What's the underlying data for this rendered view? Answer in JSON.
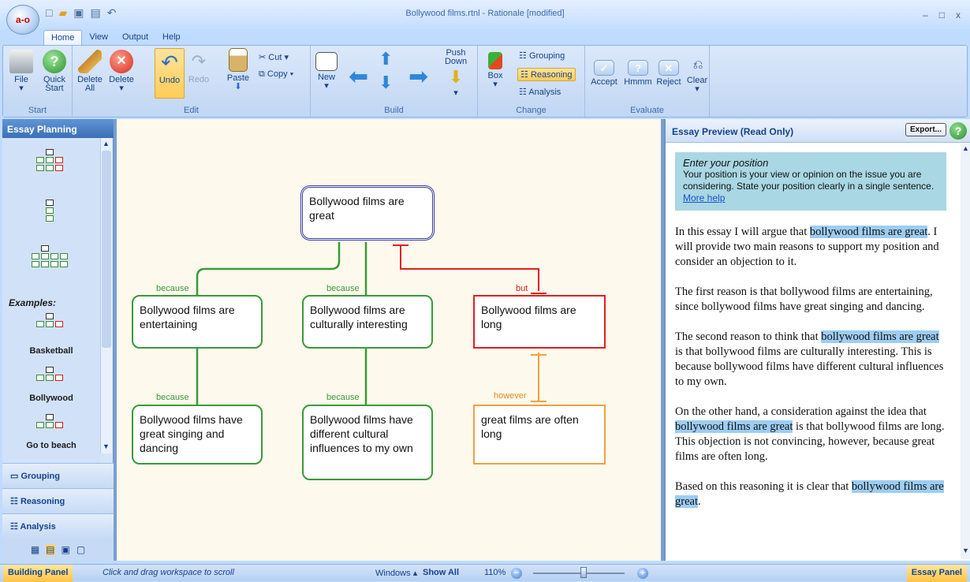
{
  "window": {
    "title": "Bollywood films.rtnl - Rationale [modified]",
    "orb_logo": "a-o",
    "controls": [
      "–",
      "□",
      "x"
    ]
  },
  "quick_access": [
    "new-icon",
    "open-icon",
    "save-icon",
    "print-icon",
    "undo-icon"
  ],
  "tabs": [
    "Home",
    "View",
    "Output",
    "Help"
  ],
  "ribbon": {
    "start": {
      "label": "Start",
      "file": "File",
      "quick_start": "Quick Start"
    },
    "edit": {
      "label": "Edit",
      "delete_all": "Delete All",
      "delete": "Delete",
      "undo": "Undo",
      "redo": "Redo",
      "paste": "Paste",
      "cut": "Cut",
      "copy": "Copy"
    },
    "build": {
      "label": "Build",
      "new": "New",
      "push_down": "Push Down"
    },
    "change": {
      "label": "Change",
      "box": "Box",
      "grouping": "Grouping",
      "reasoning": "Reasoning",
      "analysis": "Analysis"
    },
    "evaluate": {
      "label": "Evaluate",
      "accept": "Accept",
      "hmmm": "Hmmm",
      "reject": "Reject",
      "clear": "Clear"
    }
  },
  "left_panel": {
    "title": "Essay Planning",
    "examples_label": "Examples:",
    "examples": [
      "Basketball",
      "Bollywood",
      "Go to beach"
    ],
    "buttons": [
      "Grouping",
      "Reasoning",
      "Analysis"
    ]
  },
  "map": {
    "root": "Bollywood films are great",
    "reason1": "Bollywood films are entertaining",
    "reason2": "Bollywood films are culturally interesting",
    "objection": "Bollywood films are long",
    "support1": "Bollywood films have great singing and dancing",
    "support2": "Bollywood films have different cultural influences to my own",
    "rebuttal": "great films are often long",
    "labels": {
      "because": "because",
      "but": "but",
      "however": "however"
    }
  },
  "right_panel": {
    "title": "Essay Preview (Read Only)",
    "export": "Export...",
    "help": "?",
    "tip_title": "Enter your position",
    "tip_body": "Your position is your view or opinion on the issue you are considering.  State your position clearly in a single sentence.",
    "tip_link": "More help",
    "p1a": "In this essay I will argue that ",
    "p1m": "bollywood films are great",
    "p1b": ". I will provide two main reasons to support my position and consider an objection to it.",
    "p2": "The first reason is that bollywood films are entertaining, since bollywood films have great singing and dancing.",
    "p3a": "The second reason to think that ",
    "p3m": "bollywood films are great",
    "p3b": " is that bollywood films are culturally interesting. This is because bollywood films have different cultural influences to my own.",
    "p4a": "On the other hand, a consideration against the idea that ",
    "p4m": "bollywood films are great",
    "p4b": " is that bollywood films are long.  This objection is not convincing, however, because great films are often long.",
    "p5a": "Based on this reasoning it is clear that ",
    "p5m": "bollywood films are great",
    "p5b": "."
  },
  "status": {
    "building_panel": "Building Panel",
    "hint": "Click and drag workspace to scroll",
    "windows": "Windows",
    "show_all": "Show All",
    "zoom": "110%",
    "zoom_level": 0.55,
    "essay_panel": "Essay Panel"
  },
  "colors": {
    "reason": "#3a9a3a",
    "objection": "#e02020",
    "rebuttal": "#f0a040",
    "highlight": "#9dcdf2"
  }
}
